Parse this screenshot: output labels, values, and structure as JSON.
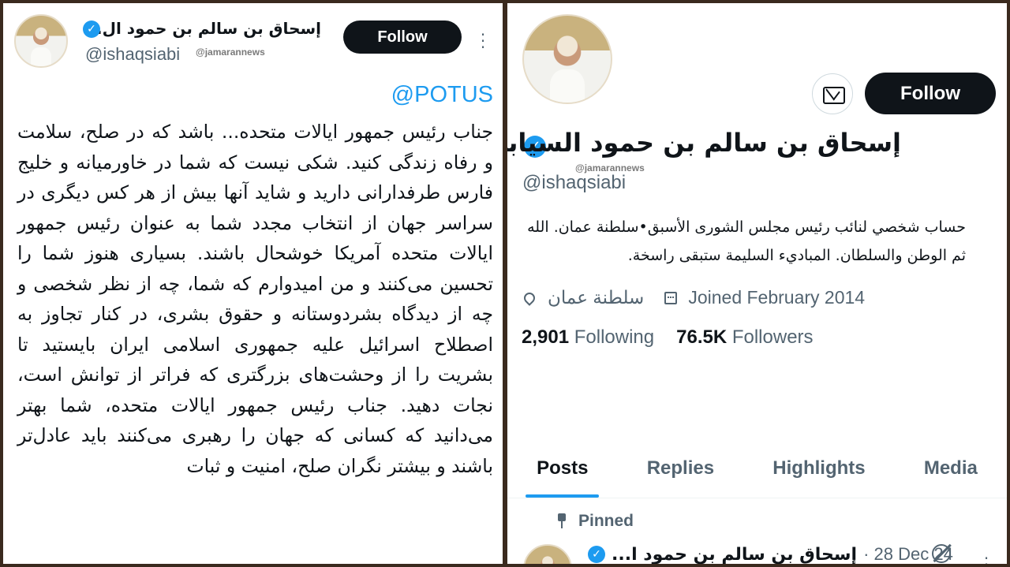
{
  "left": {
    "author_name": "إسحاق بن سالم بن حمود ال...",
    "handle": "@ishaqsiabi",
    "watermark": "@jamarannews",
    "follow_label": "Follow",
    "mention": "@POTUS",
    "body": "جناب رئیس جمهور ایالات متحده... باشد که در صلح، سلامت و رفاه زندگی کنید. شکی نیست که شما در خاورمیانه و خلیج فارس طرفدارانی دارید و شاید آنها بیش از هر کس دیگری در سراسر جهان از انتخاب مجدد شما به عنوان رئیس جمهور ایالات متحده آمریکا خوشحال باشند. بسیاری هنوز شما را تحسین می‌کنند و من امیدوارم که شما، چه از نظر شخصی و چه از دیدگاه بشردوستانه و حقوق بشری، در کنار تجاوز به اصطلاح اسرائیل علیه جمهوری اسلامی ایران بایستید تا بشریت را از وحشت‌های بزرگتری که فراتر از توانش است، نجات دهید. جناب رئیس جمهور ایالات متحده، شما بهتر می‌دانید که کسانی که جهان را رهبری می‌کنند باید عادل‌تر باشند و بیشتر نگران صلح، امنیت و ثبات"
  },
  "right": {
    "follow_label": "Follow",
    "name": "إسحاق بن سالم بن حمود السيابي",
    "watermark": "@jamarannews",
    "handle": "@ishaqsiabi",
    "bio": "حساب شخصي لنائب رئيس مجلس الشورى الأسبق•سلطنة عمان. الله ثم الوطن والسلطان. المباديء السليمة ستبقى راسخة.",
    "location": "سلطنة عمان",
    "joined": "Joined February 2014",
    "following_count": "2,901",
    "following_label": "Following",
    "followers_count": "76.5K",
    "followers_label": "Followers",
    "tabs": [
      "Posts",
      "Replies",
      "Highlights",
      "Media"
    ],
    "pinned_label": "Pinned",
    "post_author": "إسحاق بن سالم بن حمود ا...",
    "post_date": "· 28 Dec 24"
  },
  "colors": {
    "accent": "#1d9bf0",
    "text": "#0f1419",
    "muted": "#536471",
    "button_bg": "#0f1419"
  },
  "icons": [
    "verified-badge-icon",
    "more-icon",
    "mail-icon",
    "location-icon",
    "calendar-icon",
    "pin-icon",
    "grok-icon"
  ]
}
